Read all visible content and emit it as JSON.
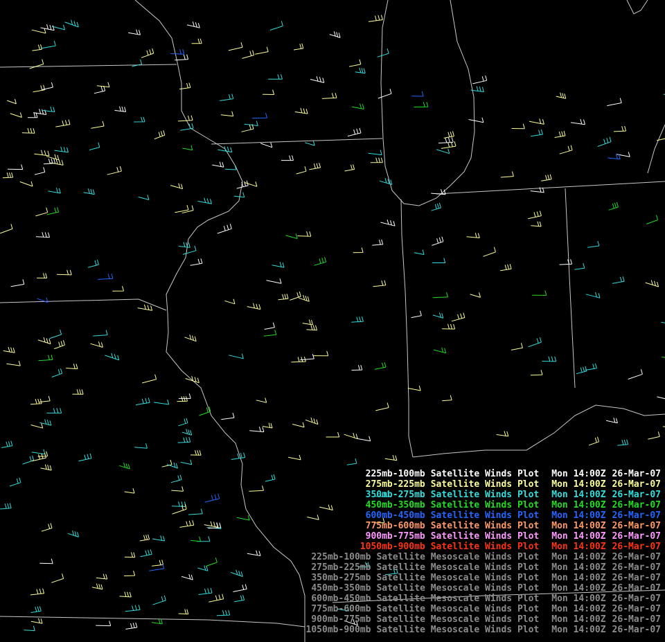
{
  "legend": {
    "rows": [
      {
        "level": "225mb-100mb",
        "product": "Satellite Winds Plot",
        "time": "Mon 14:00Z",
        "date": "26-Mar-07",
        "color": "#ffffff"
      },
      {
        "level": "275mb-225mb",
        "product": "Satellite Winds Plot",
        "time": "Mon 14:00Z",
        "date": "26-Mar-07",
        "color": "#ffff99"
      },
      {
        "level": "350mb-275mb",
        "product": "Satellite Winds Plot",
        "time": "Mon 14:00Z",
        "date": "26-Mar-07",
        "color": "#33dddd"
      },
      {
        "level": "450mb-350mb",
        "product": "Satellite Winds Plot",
        "time": "Mon 14:00Z",
        "date": "26-Mar-07",
        "color": "#22dd22"
      },
      {
        "level": "600mb-450mb",
        "product": "Satellite Winds Plot",
        "time": "Mon 14:00Z",
        "date": "26-Mar-07",
        "color": "#2266ff"
      },
      {
        "level": "775mb-600mb",
        "product": "Satellite Winds Plot",
        "time": "Mon 14:00Z",
        "date": "26-Mar-07",
        "color": "#ff9966"
      },
      {
        "level": "900mb-775mb",
        "product": "Satellite Winds Plot",
        "time": "Mon 14:00Z",
        "date": "26-Mar-07",
        "color": "#ff99ff"
      },
      {
        "level": "1050mb-900mb",
        "product": "Satellite Winds Plot",
        "time": "Mon 14:00Z",
        "date": "26-Mar-07",
        "color": "#ff3311"
      },
      {
        "level": "225mb-100mb",
        "product": "Satellite Mesoscale Winds Plot",
        "time": "Mon 14:00Z",
        "date": "26-Mar-07",
        "color": "#8c8c8c"
      },
      {
        "level": "275mb-225mb",
        "product": "Satellite Mesoscale Winds Plot",
        "time": "Mon 14:00Z",
        "date": "26-Mar-07",
        "color": "#8c8c8c"
      },
      {
        "level": "350mb-275mb",
        "product": "Satellite Mesoscale Winds Plot",
        "time": "Mon 14:00Z",
        "date": "26-Mar-07",
        "color": "#8c8c8c"
      },
      {
        "level": "450mb-350mb",
        "product": "Satellite Mesoscale Winds Plot",
        "time": "Mon 14:00Z",
        "date": "26-Mar-07",
        "color": "#8c8c8c"
      },
      {
        "level": "600mb-450mb",
        "product": "Satellite Mesoscale Winds Plot",
        "time": "Mon 14:00Z",
        "date": "26-Mar-07",
        "color": "#8c8c8c"
      },
      {
        "level": "775mb-600mb",
        "product": "Satellite Mesoscale Winds Plot",
        "time": "Mon 14:00Z",
        "date": "26-Mar-07",
        "color": "#8c8c8c"
      },
      {
        "level": "900mb-775mb",
        "product": "Satellite Mesoscale Winds Plot",
        "time": "Mon 14:00Z",
        "date": "26-Mar-07",
        "color": "#8c8c8c"
      },
      {
        "level": "1050mb-900mb",
        "product": "Satellite Mesoscale Winds Plot",
        "time": "Mon 14:00Z",
        "date": "26-Mar-07",
        "color": "#8c8c8c"
      }
    ]
  },
  "map_style": {
    "background": "#000000",
    "boundary_color": "#c8c8c8"
  }
}
